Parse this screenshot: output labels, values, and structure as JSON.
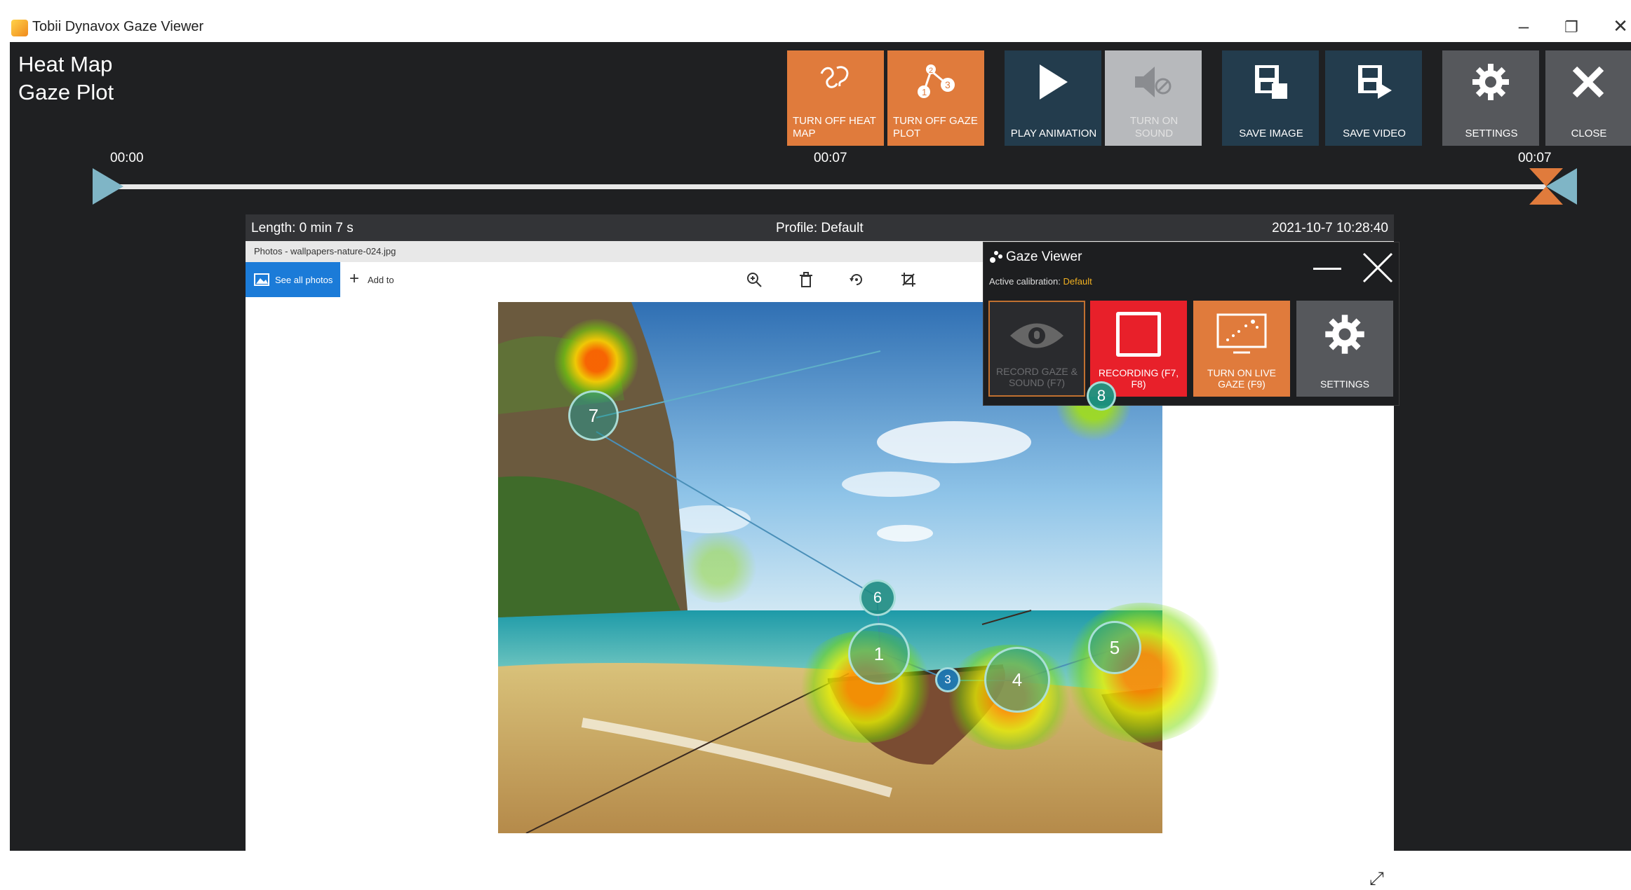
{
  "window": {
    "title": "Tobii Dynavox Gaze Viewer"
  },
  "legend": {
    "heat_map": "Heat Map",
    "gaze_plot": "Gaze Plot"
  },
  "toolbar": {
    "heat_map_btn": "TURN OFF HEAT MAP",
    "gaze_plot_btn": "TURN OFF GAZE PLOT",
    "play_btn": "PLAY ANIMATION",
    "sound_btn": "TURN ON SOUND",
    "save_image_btn": "SAVE IMAGE",
    "save_video_btn": "SAVE VIDEO",
    "settings_btn": "SETTINGS",
    "close_btn": "CLOSE"
  },
  "timeline": {
    "start": "00:00",
    "current": "00:07",
    "end": "00:07"
  },
  "info": {
    "length": "Length: 0 min 7 s",
    "profile": "Profile: Default",
    "datetime": "2021-10-7 10:28:40"
  },
  "photos": {
    "title": "Photos - wallpapers-nature-024.jpg",
    "see_all": "See all photos",
    "add_to": "Add to"
  },
  "gaze_viewer": {
    "title": "Gaze Viewer",
    "calibration_label": "Active calibration:",
    "calibration_value": "Default",
    "record_btn": "RECORD GAZE & SOUND (F7)",
    "recording_btn": "RECORDING (F7, F8)",
    "live_btn": "TURN ON LIVE GAZE (F9)",
    "settings_btn": "SETTINGS"
  },
  "fixations": [
    "1",
    "3",
    "4",
    "5",
    "6",
    "7",
    "8"
  ],
  "colors": {
    "orange": "#e07b3c",
    "blue": "#233c4d",
    "grey": "#56585c",
    "record_red": "#e8202a",
    "accent_teal": "#7fb5c6"
  }
}
